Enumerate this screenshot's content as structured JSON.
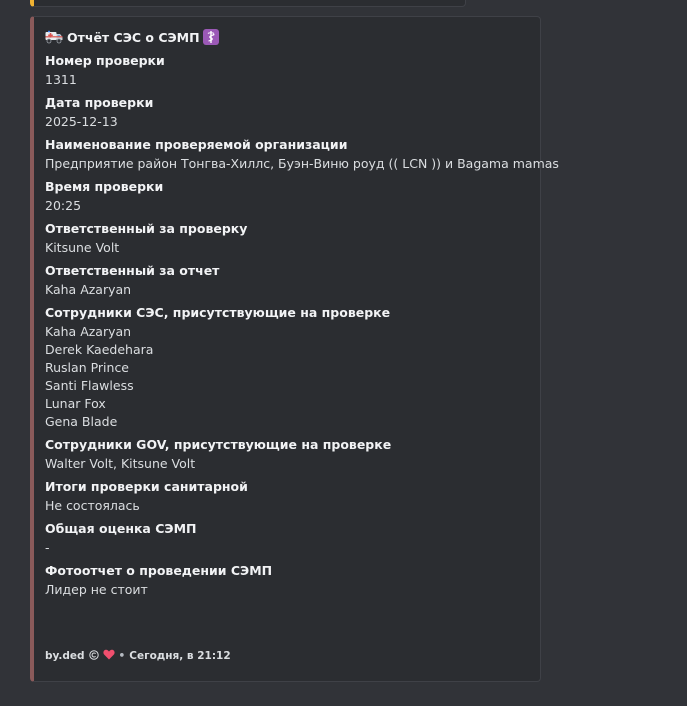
{
  "embed": {
    "title": "Отчёт СЭС о СЭМП",
    "title_icon_left": "ambulance-icon",
    "title_icon_right": "medical-symbol-icon",
    "accent_color": "#8a5a5a",
    "fields": [
      {
        "name": "Номер проверки",
        "lines": [
          "1311"
        ]
      },
      {
        "name": "Дата проверки",
        "lines": [
          "2025-12-13"
        ]
      },
      {
        "name": "Наименование проверяемой организации",
        "lines": [
          "Предприятие район Тонгва-Хиллс, Буэн-Виню роуд (( LCN )) и Bagama mamas"
        ]
      },
      {
        "name": "Время проверки",
        "lines": [
          "20:25"
        ]
      },
      {
        "name": "Ответственный за проверку",
        "lines": [
          "Kitsune Volt"
        ]
      },
      {
        "name": "Ответственный за отчет",
        "lines": [
          "Kaha Azaryan"
        ]
      },
      {
        "name": "Сотрудники СЭС, присутствующие на проверке",
        "lines": [
          "Kaha Azaryan",
          "Derek Kaedehara",
          "Ruslan Prince",
          "Santi Flawless",
          "Lunar Fox",
          "Gena Blade"
        ]
      },
      {
        "name": "Сотрудники GOV, присутствующие на проверке",
        "lines": [
          "Walter Volt, Kitsune Volt"
        ]
      },
      {
        "name": "Итоги проверки санитарной",
        "lines": [
          "Не состоялась"
        ]
      },
      {
        "name": "Общая оценка СЭМП",
        "lines": [
          "-"
        ]
      },
      {
        "name": "Фотоотчет о проведении СЭМП",
        "lines": [
          "Лидер не стоит"
        ]
      }
    ],
    "footer": {
      "author": "by.ded",
      "icons": [
        "copyright-icon",
        "heart-icon"
      ],
      "separator": "•",
      "timestamp": "Сегодня, в 21:12"
    }
  },
  "colors": {
    "background": "#313338",
    "embed_background": "#2b2d31",
    "previous_embed_accent": "#f0b232",
    "heart": "#f04f6e",
    "medical_badge": "#9b59b6"
  }
}
